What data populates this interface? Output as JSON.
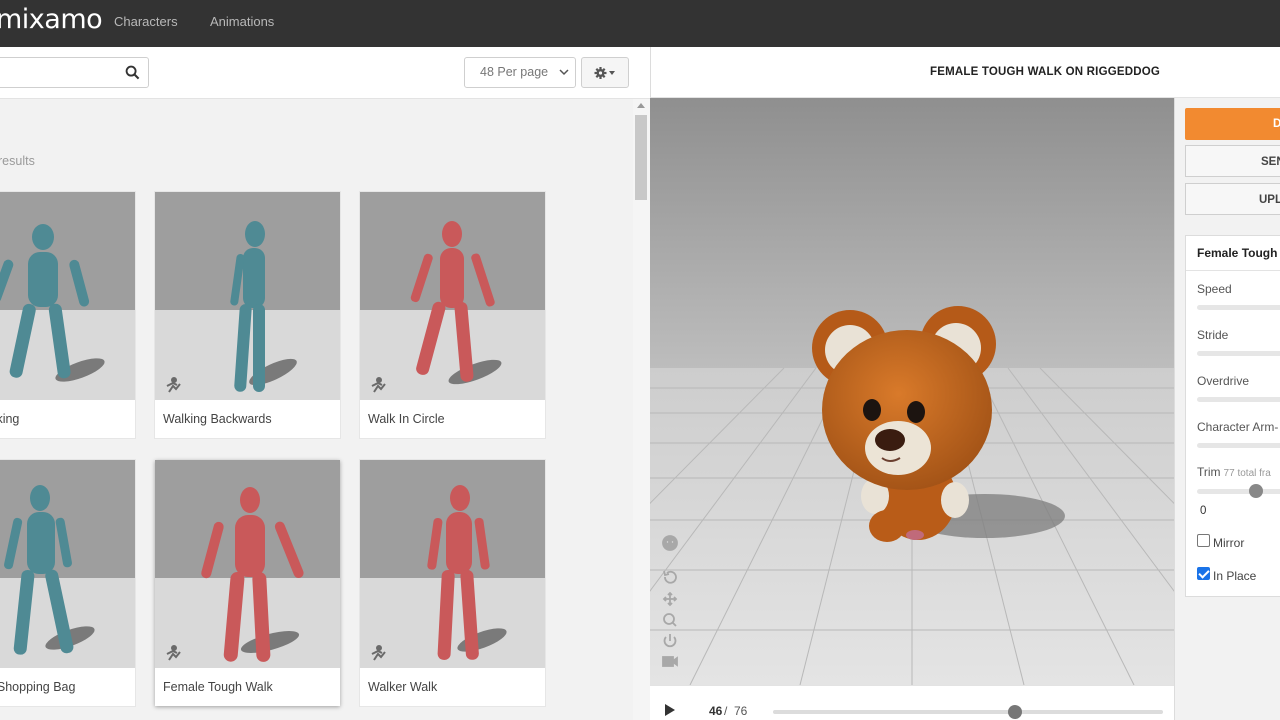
{
  "topbar": {
    "logo": "mixamo",
    "nav": [
      {
        "label": "Characters"
      },
      {
        "label": "Animations"
      }
    ]
  },
  "toolbar": {
    "search_value": "",
    "per_page": "48 Per page"
  },
  "results_text": "results",
  "cards": [
    {
      "label": "ed Walking",
      "figure": "teal"
    },
    {
      "label": "Walking Backwards",
      "figure": "teal"
    },
    {
      "label": "Walk In Circle",
      "figure": "red"
    },
    {
      "label": "g With Shopping Bag",
      "figure": "teal"
    },
    {
      "label": "Female Tough Walk",
      "figure": "red",
      "selected": true
    },
    {
      "label": "Walker Walk",
      "figure": "red"
    }
  ],
  "viewer": {
    "title": "FEMALE TOUGH WALK ON RIGGEDDOG",
    "current_frame": "46",
    "separator": "/",
    "total_frames": "76",
    "timeline_progress": 0.62
  },
  "sidepanel": {
    "download_label": "DO",
    "send_label": "SEN",
    "upload_label": "UPLOA",
    "settings_title": "Female Tough",
    "params": [
      {
        "label": "Speed"
      },
      {
        "label": "Stride"
      },
      {
        "label": "Overdrive"
      },
      {
        "label": "Character Arm-"
      }
    ],
    "trim_label": "Trim",
    "trim_sub": "77 total fra",
    "trim_value": "0",
    "mirror_label": "Mirror",
    "mirror_checked": false,
    "inplace_label": "In Place",
    "inplace_checked": true
  },
  "colors": {
    "topbar": "#333333",
    "accent_orange": "#f28a30",
    "teal_figure": "#4f8a94",
    "red_figure": "#c9595a",
    "bear": "#c8631c"
  }
}
